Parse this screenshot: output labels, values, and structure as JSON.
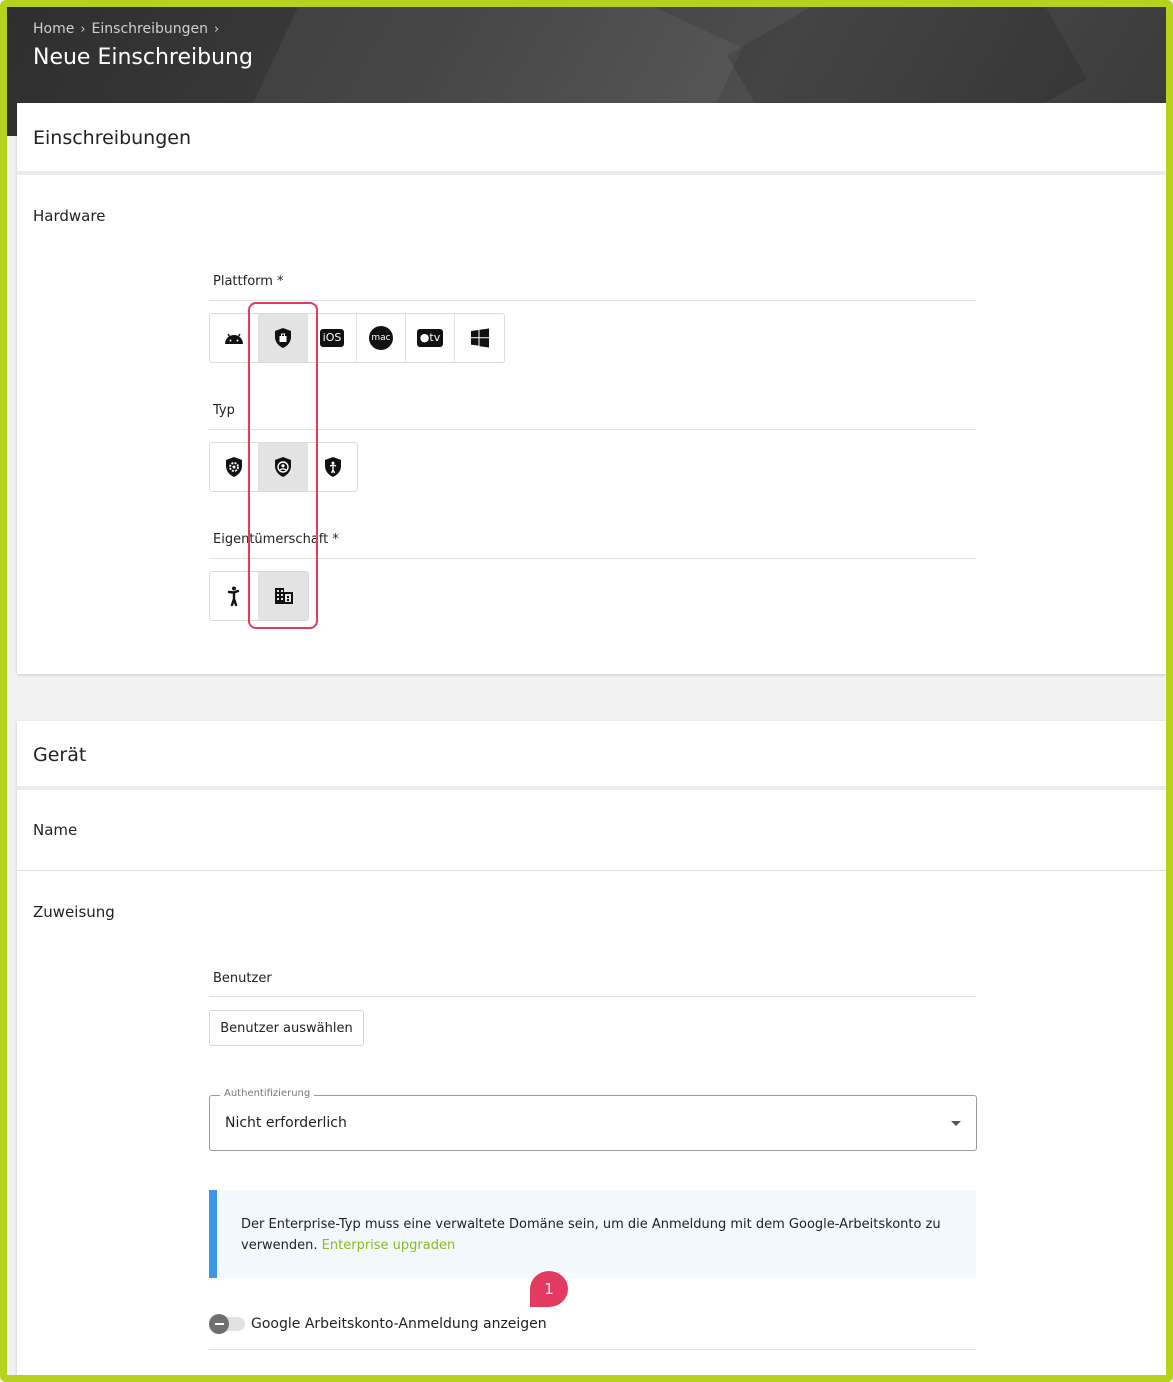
{
  "header": {
    "breadcrumb": [
      "Home",
      "Einschreibungen"
    ],
    "title": "Neue Einschreibung"
  },
  "enrollments_card": {
    "title": "Einschreibungen",
    "section": "Hardware",
    "platform": {
      "label": "Plattform *",
      "options": [
        "android-icon",
        "android-enterprise-icon",
        "ios-icon",
        "macos-icon",
        "apple-tv-icon",
        "windows-icon"
      ],
      "ios_text": "iOS",
      "mac_text": "mac",
      "tv_text": "tv",
      "selected": "android-enterprise-icon"
    },
    "type": {
      "label": "Typ",
      "options": [
        "fully-managed-icon",
        "work-profile-icon",
        "dedicated-device-icon"
      ],
      "selected": "work-profile-icon"
    },
    "ownership": {
      "label": "Eigentümerschaft *",
      "options": [
        "personal-icon",
        "company-building-icon"
      ],
      "selected": "company-building-icon"
    }
  },
  "device_card": {
    "title": "Gerät",
    "name_label": "Name",
    "assignment_label": "Zuweisung",
    "user_label": "Benutzer",
    "select_user_button": "Benutzer auswählen",
    "auth": {
      "legend": "Authentifizierung",
      "value": "Nicht erforderlich"
    },
    "info": {
      "text": "Der Enterprise-Typ muss eine verwaltete Domäne sein, um die Anmeldung mit dem Google-Arbeitskonto zu verwenden.",
      "link": "Enterprise upgraden"
    },
    "step_badge": "1",
    "toggle_label": "Google Arbeitskonto-Anmeldung anzeigen",
    "toggle_state": "off"
  },
  "colors": {
    "frame": "#b6d21c",
    "highlight": "#e33a62",
    "info_border": "#3b95e8",
    "link": "#8dbb22"
  }
}
